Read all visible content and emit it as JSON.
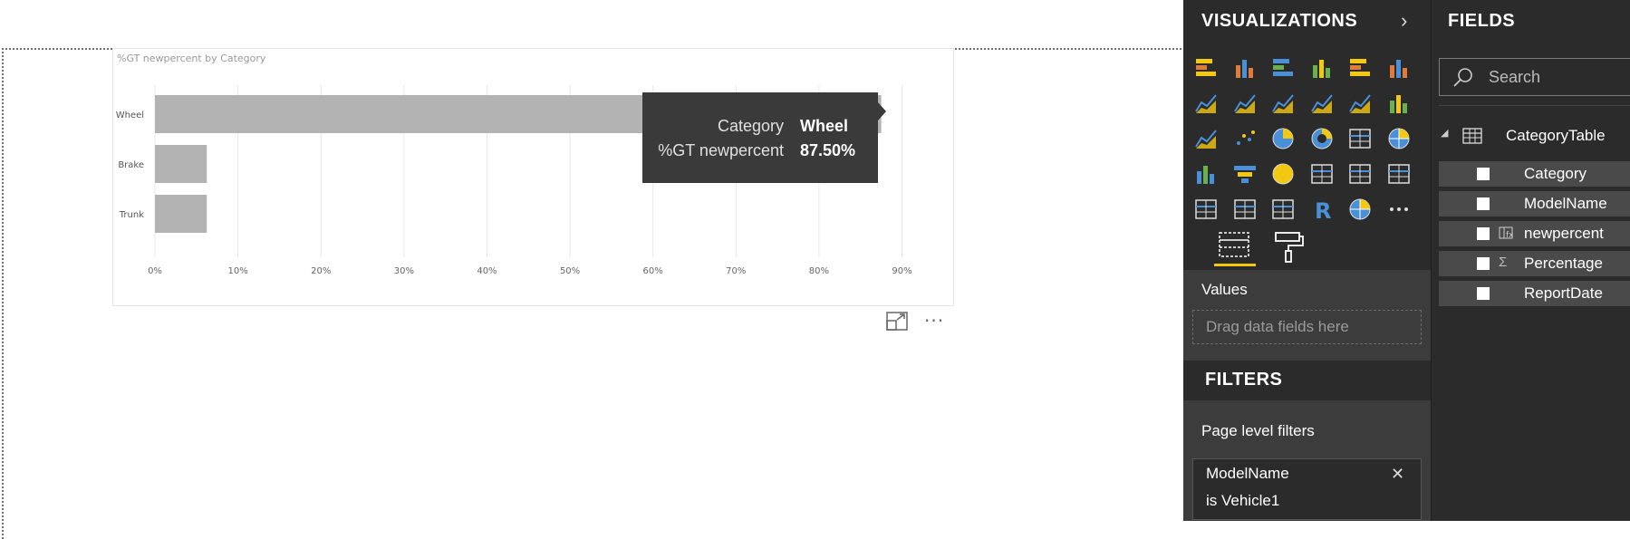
{
  "canvas": {
    "more_options": "···"
  },
  "chart": {
    "title": "%GT newpercent by Category",
    "bar_color": "#b3b3b3",
    "grid_color": "#e8e8e8"
  },
  "chart_data": {
    "type": "bar",
    "orientation": "horizontal",
    "title": "%GT newpercent by Category",
    "categories": [
      "Wheel",
      "Brake",
      "Trunk"
    ],
    "values": [
      87.5,
      6.25,
      6.25
    ],
    "x_ticks": [
      "0%",
      "10%",
      "20%",
      "30%",
      "40%",
      "50%",
      "60%",
      "70%",
      "80%",
      "90%"
    ],
    "xlim": [
      0,
      90
    ],
    "grid": true,
    "xlabel": "",
    "ylabel": ""
  },
  "tooltip": {
    "rows": [
      {
        "key": "Category",
        "value": "Wheel"
      },
      {
        "key": "%GT newpercent",
        "value": "87.50%"
      }
    ]
  },
  "visualizations": {
    "title": "VISUALIZATIONS",
    "collapse_glyph": "›",
    "icons": [
      "stacked-bar-chart-icon",
      "stacked-column-chart-icon",
      "clustered-bar-chart-icon",
      "clustered-column-chart-icon",
      "100-stacked-bar-chart-icon",
      "100-stacked-column-chart-icon",
      "line-chart-icon",
      "area-chart-icon",
      "stacked-area-chart-icon",
      "line-and-stacked-column-chart-icon",
      "line-and-clustered-column-chart-icon",
      "waterfall-chart-icon",
      "ribbon-chart-icon",
      "scatter-chart-icon",
      "pie-chart-icon",
      "donut-chart-icon",
      "treemap-icon",
      "map-icon",
      "filled-map-icon",
      "funnel-icon",
      "gauge-icon",
      "card-icon",
      "multi-row-card-icon",
      "kpi-icon",
      "slicer-icon",
      "table-icon",
      "matrix-icon",
      "r-script-visual-icon",
      "arcgis-map-icon",
      "more-visuals-icon"
    ],
    "values_label": "Values",
    "drag_placeholder": "Drag data fields here",
    "filters_title": "FILTERS",
    "page_filters_label": "Page level filters",
    "filter": {
      "field": "ModelName",
      "condition": "is Vehicle1",
      "close_glyph": "✕"
    }
  },
  "fields": {
    "title": "FIELDS",
    "search_placeholder": "Search",
    "table": {
      "name": "CategoryTable",
      "caret": "◢",
      "items": [
        {
          "name": "Category",
          "type": "none"
        },
        {
          "name": "ModelName",
          "type": "none"
        },
        {
          "name": "newpercent",
          "type": "calc"
        },
        {
          "name": "Percentage",
          "type": "sum"
        },
        {
          "name": "ReportDate",
          "type": "none"
        }
      ]
    },
    "sum_glyph": "Σ"
  }
}
